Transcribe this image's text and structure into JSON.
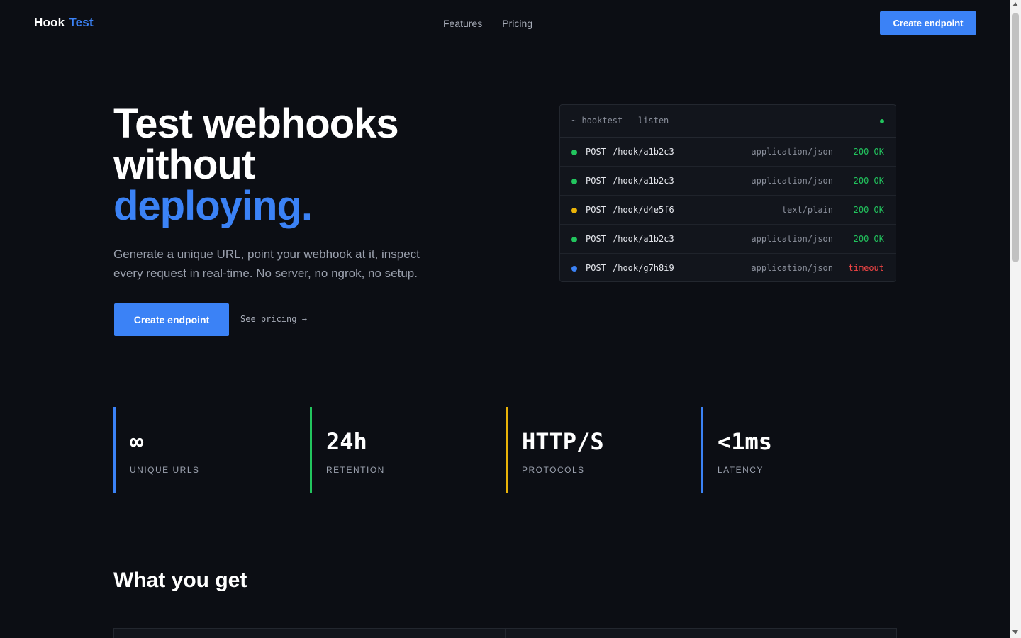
{
  "nav": {
    "logo_part1": "Hook",
    "logo_part2": "Test",
    "links": [
      "Features",
      "Pricing"
    ],
    "cta": "Create endpoint"
  },
  "hero": {
    "title_line1": "Test webhooks",
    "title_line2": "without",
    "title_line3": "deploying.",
    "subtitle": "Generate a unique URL, point your webhook at it, inspect every request in real-time. No server, no ngrok, no setup.",
    "cta": "Create endpoint",
    "secondary": "See pricing →"
  },
  "terminal": {
    "command": "~ hooktest --listen",
    "rows": [
      {
        "method": "POST",
        "path": "/hook/a1b2c3",
        "content_type": "application/json",
        "status": "200 OK",
        "dot_color": "#22c55e",
        "status_kind": "ok"
      },
      {
        "method": "POST",
        "path": "/hook/a1b2c3",
        "content_type": "application/json",
        "status": "200 OK",
        "dot_color": "#22c55e",
        "status_kind": "ok"
      },
      {
        "method": "POST",
        "path": "/hook/d4e5f6",
        "content_type": "text/plain",
        "status": "200 OK",
        "dot_color": "#eab308",
        "status_kind": "ok"
      },
      {
        "method": "POST",
        "path": "/hook/a1b2c3",
        "content_type": "application/json",
        "status": "200 OK",
        "dot_color": "#22c55e",
        "status_kind": "ok"
      },
      {
        "method": "POST",
        "path": "/hook/g7h8i9",
        "content_type": "application/json",
        "status": "timeout",
        "dot_color": "#3b82f6",
        "status_kind": "err"
      }
    ]
  },
  "stats": [
    {
      "value": "∞",
      "label": "UNIQUE URLS",
      "color": "#3b82f6"
    },
    {
      "value": "24h",
      "label": "RETENTION",
      "color": "#22c55e"
    },
    {
      "value": "HTTP/S",
      "label": "PROTOCOLS",
      "color": "#eab308"
    },
    {
      "value": "<1ms",
      "label": "LATENCY",
      "color": "#3b82f6"
    }
  ],
  "features": {
    "title": "What you get"
  },
  "colors": {
    "accent": "#3b82f6",
    "success": "#22c55e",
    "warning": "#eab308",
    "error": "#ef4444",
    "background": "#0c0e14"
  }
}
